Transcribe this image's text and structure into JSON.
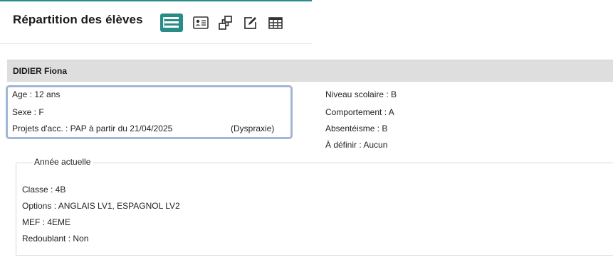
{
  "header": {
    "title": "Répartition des élèves",
    "buttons": [
      {
        "icon": "list-view-icon",
        "active": true
      },
      {
        "icon": "id-card-icon",
        "active": false
      },
      {
        "icon": "hierarchy-icon",
        "active": false
      },
      {
        "icon": "edit-icon",
        "active": false
      },
      {
        "icon": "table-grid-icon",
        "active": false
      }
    ],
    "accent_color": "#2a8c88"
  },
  "student": {
    "name": "DIDIER Fiona"
  },
  "details": {
    "age": "Age : 12 ans",
    "sexe": "Sexe : F",
    "projets": "Projets d'acc. : PAP à partir du 21/04/2025",
    "projets_note": "(Dyspraxie)",
    "niveau": "Niveau scolaire : B",
    "comportement": "Comportement : A",
    "absenteisme": "Absentéisme : B",
    "a_definir": "À définir : Aucun"
  },
  "annee_actuelle": {
    "legend": "Année actuelle",
    "classe": "Classe : 4B",
    "options": "Options : ANGLAIS LV1, ESPAGNOL LV2",
    "mef": "MEF : 4EME",
    "redoublant": "Redoublant : Non"
  },
  "colors": {
    "highlight_border": "#a3b6d6",
    "student_bar_bg": "#dedede"
  }
}
